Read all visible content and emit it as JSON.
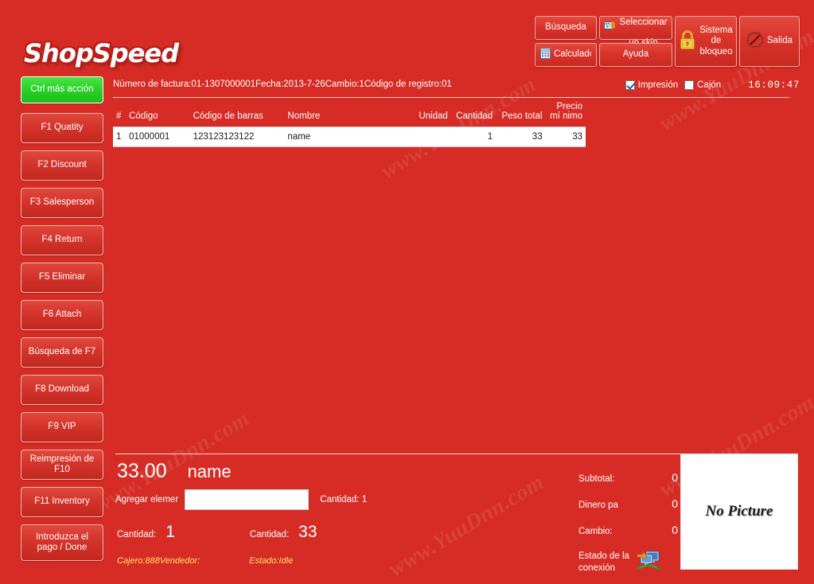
{
  "app": {
    "logo_text": "ShopSpeed",
    "background_color": "#d62c25",
    "accent_green": "#2bd02a",
    "watermark_text": "www.YuuDnn.com"
  },
  "toolbar": {
    "buttons": [
      {
        "label": "Búsqueda",
        "icon": ""
      },
      {
        "label": "Calculadora",
        "icon": "calculator-icon"
      },
      {
        "label": "Seleccionar\nun skin",
        "icon": "skin-palette-icon"
      },
      {
        "label": "Ayuda",
        "icon": ""
      },
      {
        "label": "Sistema\nde\nbloqueo",
        "icon": "lock-icon"
      },
      {
        "label": "Salida",
        "icon": "exit-forbidden-icon"
      }
    ],
    "search_label": "Búsqueda",
    "calculator_label": "Calculadora",
    "skin_label_line1": "Seleccionar",
    "skin_label_line2": "un skin",
    "help_label": "Ayuda",
    "lock_label_line1": "Sistema",
    "lock_label_line2": "de",
    "lock_label_line3": "bloqueo",
    "exit_label": "Salida"
  },
  "options": {
    "print_label": "Impresión",
    "print_checked": true,
    "drawer_label": "Cajón",
    "drawer_checked": false,
    "clock": "16:09:47"
  },
  "sidebar": {
    "items": [
      {
        "label": "Ctrl más acción",
        "state": "active"
      },
      {
        "label": "F1 Quatity",
        "state": "normal"
      },
      {
        "label": "F2 Discount",
        "state": "normal"
      },
      {
        "label": "F3 Salesperson",
        "state": "normal"
      },
      {
        "label": "F4 Return",
        "state": "normal"
      },
      {
        "label": "F5 Eliminar",
        "state": "normal"
      },
      {
        "label": "F6 Attach",
        "state": "normal"
      },
      {
        "label": "Búsqueda de F7",
        "state": "normal"
      },
      {
        "label": "F8 Download",
        "state": "normal"
      },
      {
        "label": "F9 VIP",
        "state": "normal"
      },
      {
        "label": "Reimpresión de F10",
        "state": "normal"
      },
      {
        "label": "F11 Inventory",
        "state": "normal"
      },
      {
        "label": "Introduzca el pago / Done",
        "state": "normal"
      }
    ]
  },
  "invoice": {
    "header_line": "Número de factura:01-1307000001Fecha:2013-7-26Cambio:1Código de registro:01",
    "number_label": "Número de factura:",
    "number": "01-1307000001",
    "date_label": "Fecha:",
    "date": "2013-7-26",
    "change_label": "Cambio:",
    "change": "1",
    "register_label": "Código de registro:",
    "register": "01"
  },
  "grid": {
    "columns": [
      {
        "key": "idx",
        "label": "#",
        "align": "left"
      },
      {
        "key": "code",
        "label": "Código",
        "align": "left"
      },
      {
        "key": "barcode",
        "label": "Código de barras",
        "align": "left"
      },
      {
        "key": "name",
        "label": "Nombre",
        "align": "left"
      },
      {
        "key": "unit",
        "label": "Unidad",
        "align": "right"
      },
      {
        "key": "qty",
        "label": "Cantidad",
        "align": "right"
      },
      {
        "key": "weight",
        "label": "Peso total",
        "align": "right"
      },
      {
        "key": "price",
        "label": "Precio mí nimo",
        "align": "right"
      }
    ],
    "rows": [
      {
        "idx": "1",
        "code": "01000001",
        "barcode": "123123123122",
        "name": "name",
        "unit": "",
        "qty": "1",
        "weight": "33",
        "price": "33"
      }
    ]
  },
  "detail": {
    "price": "33.00",
    "product_name": "name",
    "add_item_label": "Agregar elemer",
    "add_item_value": "",
    "add_item_placeholder": "",
    "count_label": "Cantidad: 1",
    "qty_label": "Cantidad:",
    "qty_value": "1",
    "amount_label": "Cantidad:",
    "amount_value": "33",
    "cashier_text": "Cajero:888Vendedor:",
    "state_text": "Estado:Idle"
  },
  "totals": {
    "rows": [
      {
        "label": "Subtotal:",
        "value": "0"
      },
      {
        "label": "Dinero pa",
        "value": "0"
      },
      {
        "label": "Cambio:",
        "value": "0"
      }
    ],
    "connection_label_line1": "Estado de la",
    "connection_label_line2": "conexión",
    "connection_icon": "network-status-icon"
  },
  "picture": {
    "placeholder_text": "No Picture"
  }
}
